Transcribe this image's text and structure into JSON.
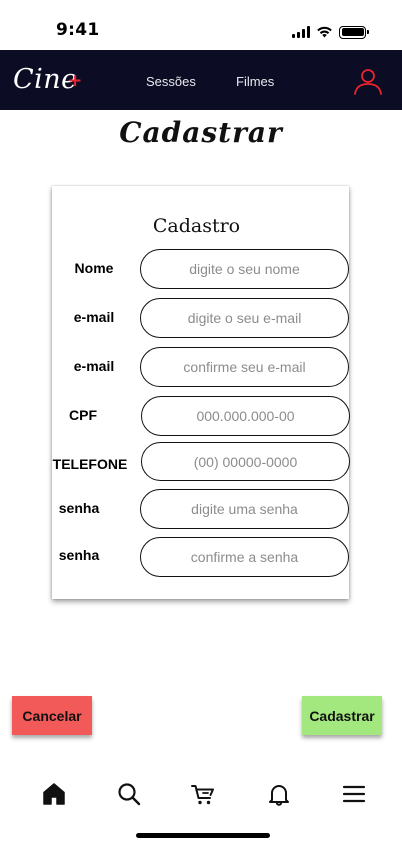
{
  "status_bar": {
    "time": "9:41"
  },
  "navbar": {
    "brand": "Cine",
    "brand_plus": "+",
    "links": [
      "Sessões",
      "Filmes"
    ]
  },
  "page": {
    "title": "Cadastrar"
  },
  "form": {
    "title": "Cadastro",
    "fields": [
      {
        "label": "Nome",
        "placeholder": "digite o seu nome",
        "value": ""
      },
      {
        "label": "e-mail",
        "placeholder": "digite o seu e-mail",
        "value": ""
      },
      {
        "label": "e-mail",
        "placeholder": "confirme seu e-mail",
        "value": ""
      },
      {
        "label": "CPF",
        "placeholder": "000.000.000-00",
        "value": ""
      },
      {
        "label": "TELEFONE",
        "placeholder": "(00) 00000-0000",
        "value": ""
      },
      {
        "label": "senha",
        "placeholder": "digite uma senha",
        "value": ""
      },
      {
        "label": "senha",
        "placeholder": "confirme a senha",
        "value": ""
      }
    ]
  },
  "actions": {
    "cancel_label": "Cancelar",
    "submit_label": "Cadastrar"
  },
  "colors": {
    "navbar_bg": "#0c0c24",
    "accent_red": "#e8242f",
    "cancel_bg": "#f25a5a",
    "submit_bg": "#a3e87e"
  },
  "tab_bar": {
    "icons": [
      "home-icon",
      "search-icon",
      "cart-icon",
      "bell-icon",
      "menu-icon"
    ],
    "active": "home-icon"
  }
}
